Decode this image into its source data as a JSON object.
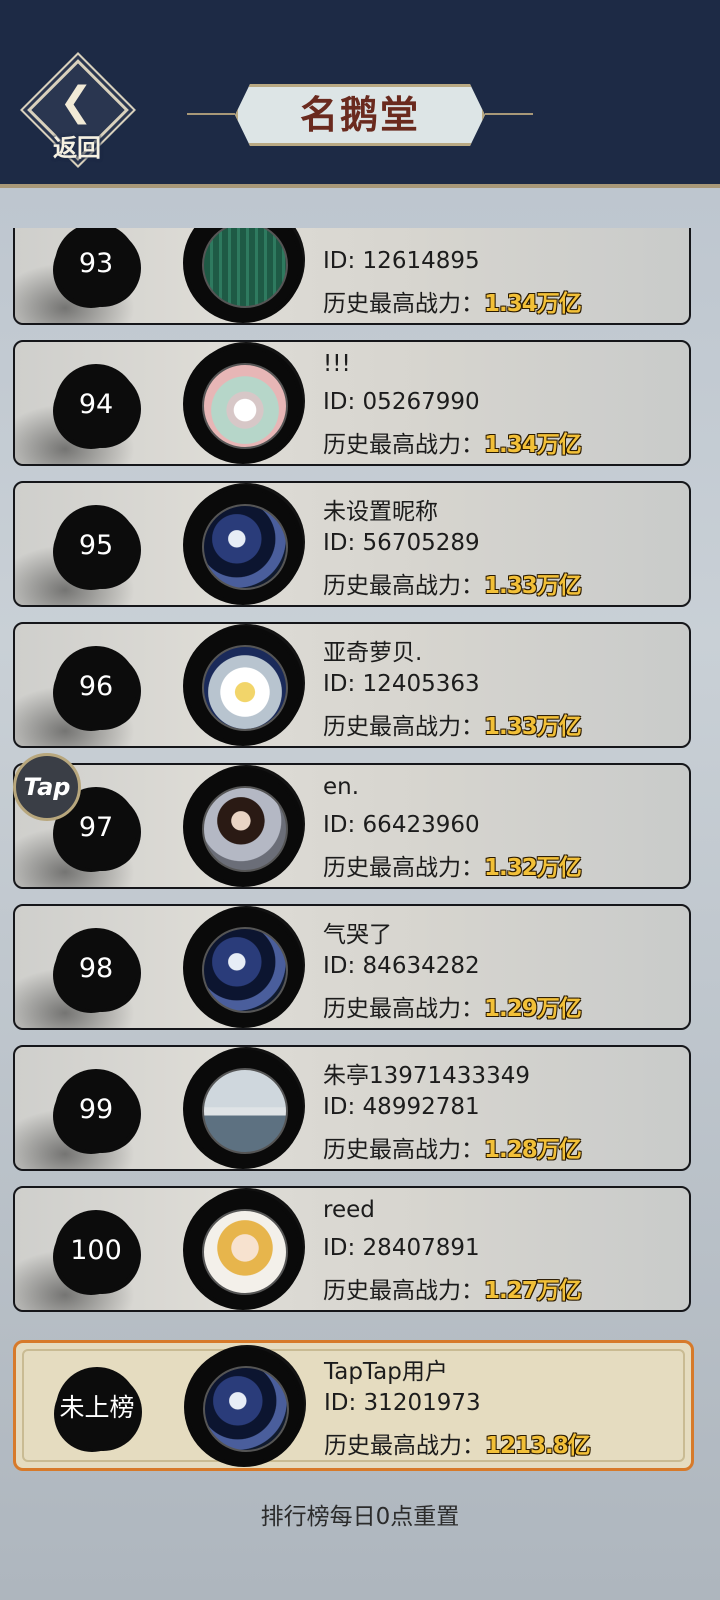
{
  "header": {
    "back_label": "返回",
    "title": "名鹅堂"
  },
  "floating": {
    "tap_label": "Tap"
  },
  "power_label": "历史最高战力：",
  "rows": [
    {
      "rank": "93",
      "name": "",
      "id": "ID: 12614895",
      "power": "1.34万亿",
      "avatar": "green-gate"
    },
    {
      "rank": "94",
      "name": "!!!",
      "id": "ID: 05267990",
      "power": "1.34万亿",
      "avatar": "wedding-photo"
    },
    {
      "rank": "95",
      "name": "未设置昵称",
      "id": "ID: 56705289",
      "power": "1.33万亿",
      "avatar": "blue-armor"
    },
    {
      "rank": "96",
      "name": "亚奇萝贝.",
      "id": "ID: 12405363",
      "power": "1.33万亿",
      "avatar": "astronaut"
    },
    {
      "rank": "97",
      "name": "en.",
      "id": "ID: 66423960",
      "power": "1.32万亿",
      "avatar": "girl-photo"
    },
    {
      "rank": "98",
      "name": "气哭了",
      "id": "ID: 84634282",
      "power": "1.29万亿",
      "avatar": "blue-armor"
    },
    {
      "rank": "99",
      "name": "朱亭13971433349",
      "id": "ID: 48992781",
      "power": "1.28万亿",
      "avatar": "sea-horizon"
    },
    {
      "rank": "100",
      "name": "reed",
      "id": "ID: 28407891",
      "power": "1.27万亿",
      "avatar": "anime-character"
    }
  ],
  "self": {
    "rank": "未上榜",
    "name": "TapTap用户",
    "id": "ID: 31201973",
    "power": "1213.8亿",
    "avatar": "blue-armor"
  },
  "footer": "排行榜每日0点重置"
}
